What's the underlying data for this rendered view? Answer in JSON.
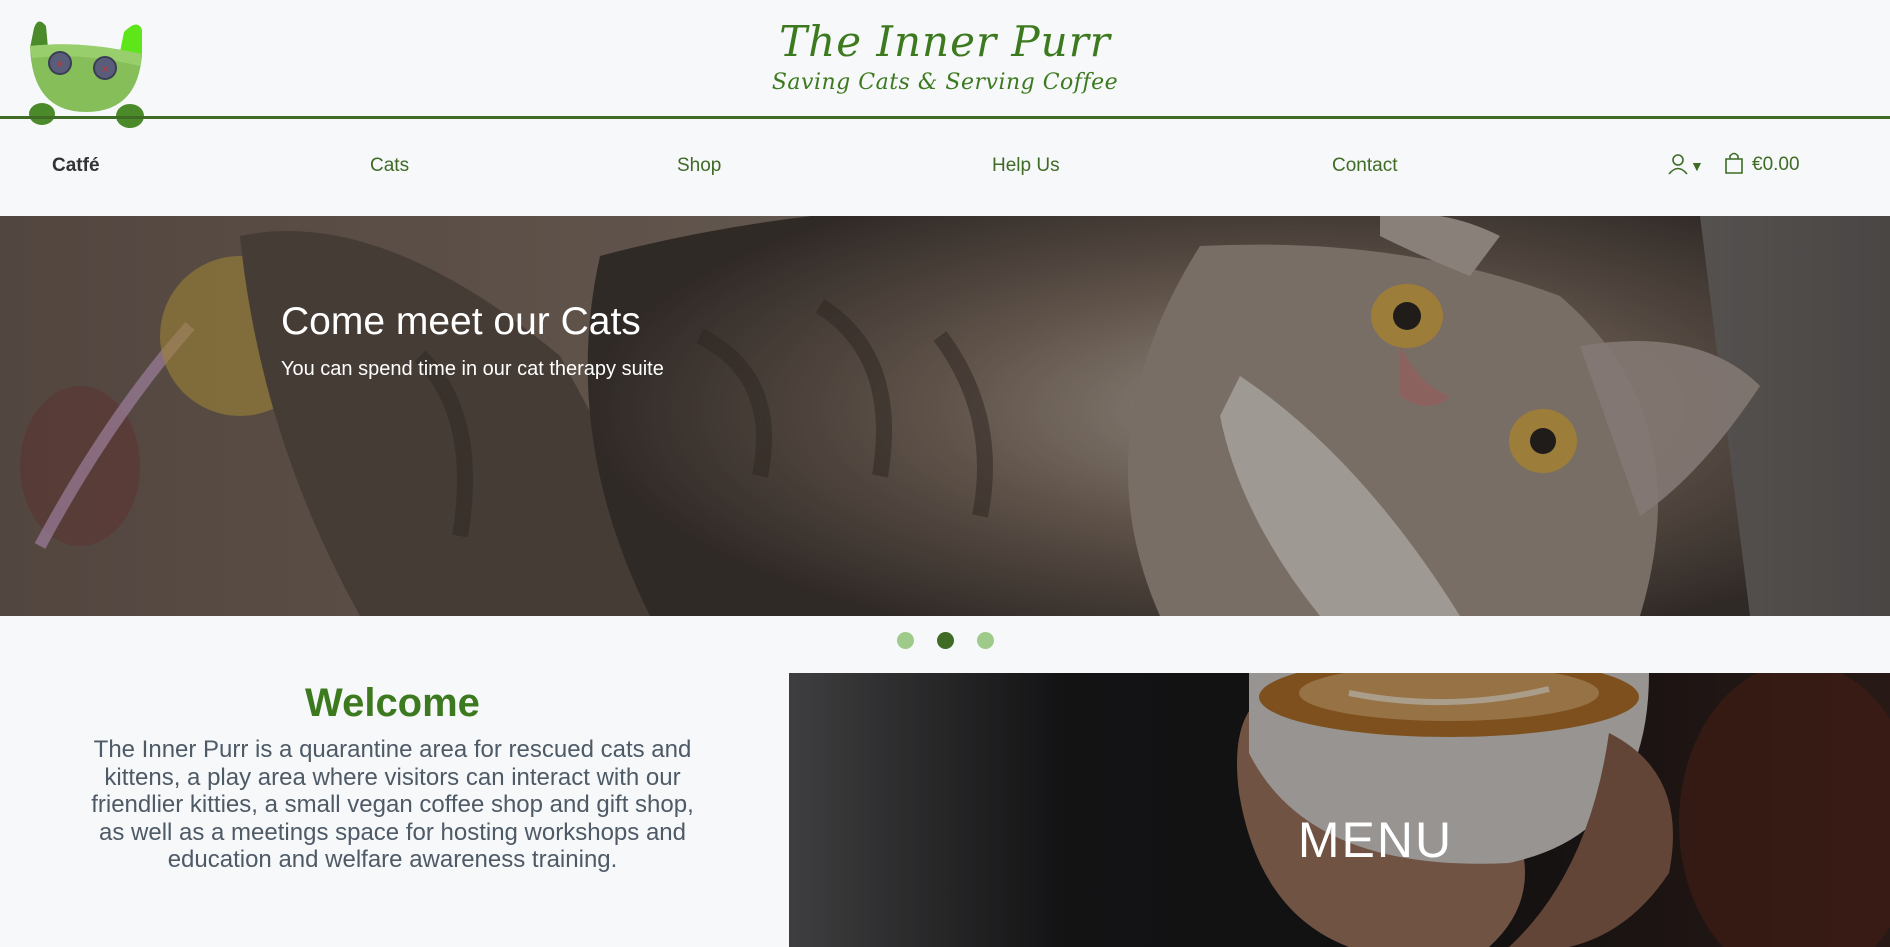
{
  "brand": {
    "title": "The Inner Purr",
    "subtitle": "Saving Cats & Serving Coffee",
    "logo_icon": "cat-logo-icon"
  },
  "nav": {
    "items": [
      {
        "label": "Catfé",
        "active": true
      },
      {
        "label": "Cats",
        "active": false
      },
      {
        "label": "Shop",
        "active": false
      },
      {
        "label": "Help Us",
        "active": false
      },
      {
        "label": "Contact",
        "active": false
      }
    ],
    "account_icon": "user-icon",
    "cart_icon": "shopping-bag-icon",
    "cart_total": "€0.00"
  },
  "hero": {
    "title": "Come meet our Cats",
    "subtitle": "You can spend time in our cat therapy suite",
    "slides_count": 3,
    "active_slide": 2
  },
  "welcome": {
    "title": "Welcome",
    "body": "The Inner Purr is a quarantine area for rescued cats and kittens, a play area where visitors can interact with our friendlier kitties, a small vegan coffee shop and gift shop, as well as a meetings space for hosting workshops and education and welfare awareness training."
  },
  "menu_panel": {
    "label": "MENU"
  },
  "colors": {
    "brand_green": "#3d7a1f",
    "nav_green": "#3f6b25",
    "dot_inactive": "#9fcb8a",
    "background": "#f6f8fa",
    "body_text": "#4e5a66"
  }
}
